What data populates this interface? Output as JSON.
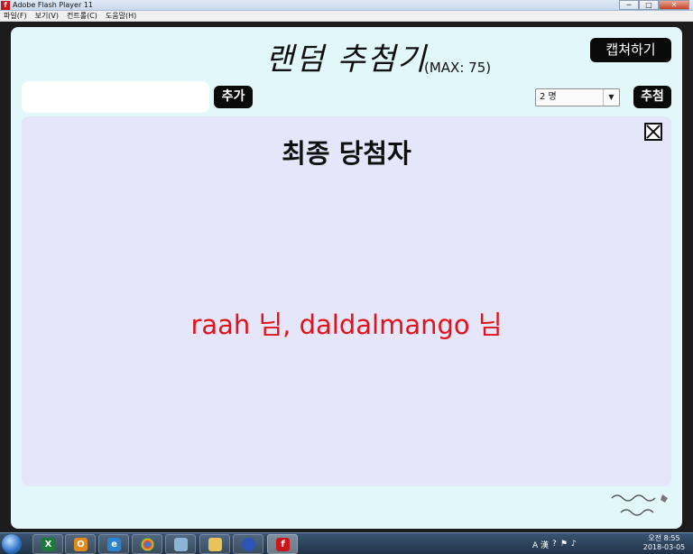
{
  "window": {
    "title": "Adobe Flash Player 11",
    "min": "─",
    "max": "□",
    "close": "✕"
  },
  "menu": [
    "파일(F)",
    "보기(V)",
    "컨트롤(C)",
    "도움말(H)"
  ],
  "app": {
    "title": "랜덤 추첨기",
    "max_label": "(MAX: 75)",
    "capture_label": "캡쳐하기",
    "input_value": "",
    "add_label": "추가",
    "count_value": "2 명",
    "draw_label": "추첨",
    "result_title": "최종 당첨자",
    "winners": "raah 님,  daldalmango 님",
    "logo_text": "달달망고와 고양이들"
  },
  "taskbar": {
    "apps": [
      "excel-icon",
      "outlook-icon",
      "ie-icon",
      "chrome-icon",
      "app-icon",
      "explorer-icon",
      "app2-icon",
      "flash-icon"
    ],
    "tray_ime": "A 漢",
    "clock_time": "오전 8:55",
    "clock_date": "2018-03-05"
  },
  "colors": {
    "panel": "#e2f7f9",
    "result_bg": "#e6e6fb",
    "winner_text": "#e2121a",
    "button": "#0a0a0a"
  }
}
